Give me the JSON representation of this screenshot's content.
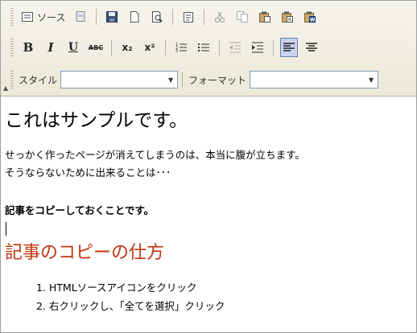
{
  "toolbar": {
    "source_label": "ソース",
    "style_label": "スタイル",
    "style_value": "",
    "format_label": "フォーマット",
    "format_value": "",
    "format_buttons": {
      "bold": "B",
      "italic": "I",
      "underline": "U",
      "strike": "ABC",
      "subscript": "x₂",
      "superscript": "x²"
    },
    "icons": [
      "source-icon",
      "templates-icon",
      "save-icon",
      "new-page-icon",
      "preview-icon",
      "paste-text-icon",
      "cut-icon",
      "copy-icon",
      "paste-icon",
      "paste-text-icon",
      "paste-word-icon",
      "numbered-list-icon",
      "bulleted-list-icon",
      "outdent-icon",
      "indent-icon",
      "align-left-icon",
      "align-center-icon"
    ],
    "accent_color": "#c8d3ec"
  },
  "content": {
    "heading": "これはサンプルです。",
    "paragraph1": "せっかく作ったページが消えてしまうのは、本当に腹が立ちます。",
    "paragraph2": "そうならないために出来ることは･･･",
    "bold_text": "記事をコピーしておくことです。",
    "subheading": "記事のコピーの仕方",
    "subheading_color": "#c0350f",
    "list": [
      "1.  HTMLソースアイコンをクリック",
      "2.  右クリックし、「全てを選択」クリック"
    ]
  }
}
